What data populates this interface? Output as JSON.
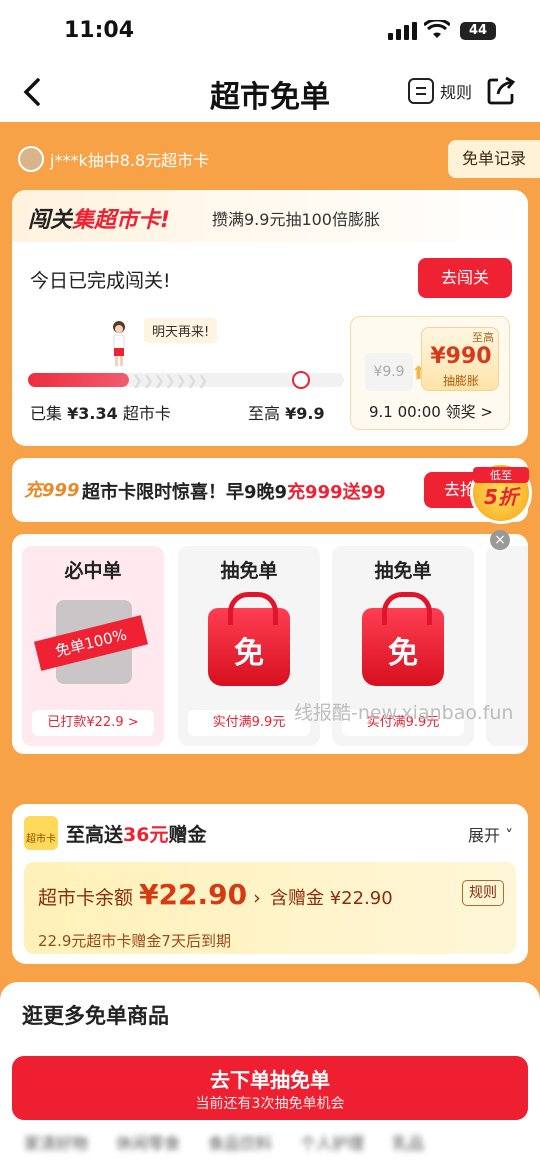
{
  "status": {
    "time": "11:04",
    "battery": "44"
  },
  "nav": {
    "title": "超市免单",
    "rules_label": "规则"
  },
  "ticker": {
    "text": "j***k抽中8.8元超市卡",
    "record_button": "免单记录"
  },
  "challenge": {
    "title_prefix": "闯关",
    "title_highlight": "集超市卡!",
    "subtitle": "攒满9.9元抽100倍膨胀",
    "status_text": "今日已完成闯关!",
    "go_button": "去闯关",
    "tip": "明天再来!",
    "progress_fraction": 0.32,
    "collected_label": "已集",
    "collected_value": "¥3.34",
    "collected_unit": "超市卡",
    "max_label": "至高",
    "max_value": "¥9.9",
    "prize_small": "¥9.9",
    "prize_tag": "至高",
    "prize_amount": "¥990",
    "prize_label": "抽膨胀",
    "prize_date": "9.1 00:00 领奖 >"
  },
  "promo": {
    "tag": "充999",
    "text_main": "超市卡限时惊喜！早9晚9",
    "text_highlight": "充999送99",
    "button": "去抢",
    "badge_top": "低至",
    "badge_main": "5折"
  },
  "products": [
    {
      "title": "必中单",
      "stamp": "免单100%",
      "footer": "已打款¥22.9 >"
    },
    {
      "title": "抽免单",
      "bag_text": "免",
      "footer": "实付满9.9元"
    },
    {
      "title": "抽免单",
      "bag_text": "免",
      "footer": "实付满9.9元"
    }
  ],
  "watermark": "线报酷-new.xianbao.fun",
  "bonus": {
    "icon_text": "超市卡",
    "title_prefix": "至高送",
    "title_highlight": "36元",
    "title_suffix": "赠金",
    "expand": "展开 ˅",
    "balance_label": "超市卡余额",
    "balance_value": "¥22.90",
    "gift_label": "含赠金 ¥22.90",
    "rules": "规则",
    "note": "22.9元超市卡赠金7天后到期"
  },
  "lower": {
    "title": "逛更多免单商品"
  },
  "cta": {
    "main": "去下单抽免单",
    "sub": "当前还有3次抽免单机会"
  },
  "tabs": [
    "家清好物",
    "休闲零食",
    "食品饮料",
    "个人护理",
    "乳品"
  ]
}
